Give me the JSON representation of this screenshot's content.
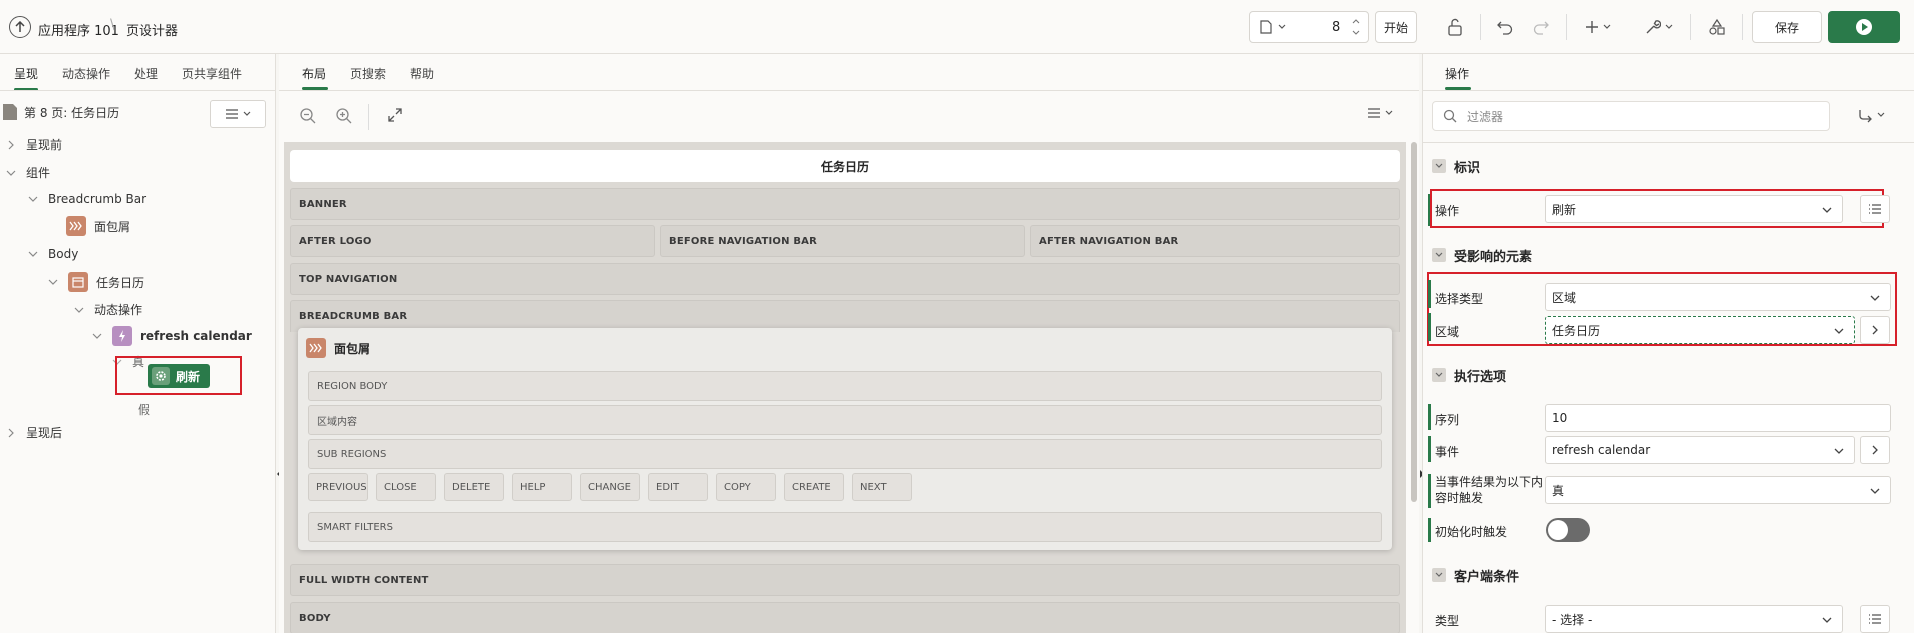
{
  "header": {
    "app_label": "应用程序 101",
    "page_label": "页设计器",
    "page_number": "8",
    "start_label": "开始",
    "save_label": "保存"
  },
  "left": {
    "tabs": [
      "呈现",
      "动态操作",
      "处理",
      "页共享组件"
    ],
    "page_title": "第 8 页: 任务日历",
    "tree": {
      "pre_render": "呈现前",
      "components": "组件",
      "breadcrumb_bar": "Breadcrumb Bar",
      "breadcrumb": "面包屑",
      "body": "Body",
      "task_calendar": "任务日历",
      "dynamic_actions": "动态操作",
      "refresh_calendar": "refresh calendar",
      "true_label": "真",
      "refresh_action": "刷新",
      "false_label": "假",
      "post_render": "呈现后"
    }
  },
  "middle": {
    "tabs": [
      "布局",
      "页搜索",
      "帮助"
    ],
    "canvas": {
      "page_title": "任务日历",
      "banner": "BANNER",
      "after_logo": "AFTER LOGO",
      "before_nav": "BEFORE NAVIGATION BAR",
      "after_nav": "AFTER NAVIGATION BAR",
      "top_nav": "TOP NAVIGATION",
      "breadcrumb_bar": "BREADCRUMB BAR",
      "region_title": "面包屑",
      "region_body": "REGION BODY",
      "region_content": "区域内容",
      "sub_regions": "SUB REGIONS",
      "buttons": [
        "PREVIOUS",
        "CLOSE",
        "DELETE",
        "HELP",
        "CHANGE",
        "EDIT",
        "COPY",
        "CREATE",
        "NEXT"
      ],
      "smart_filters": "SMART FILTERS",
      "full_width": "FULL WIDTH CONTENT",
      "body": "BODY"
    }
  },
  "right": {
    "tab": "操作",
    "filter_placeholder": "过滤器",
    "sections": {
      "identification": "标识",
      "affected": "受影响的元素",
      "execution": "执行选项",
      "client_condition": "客户端条件"
    },
    "props": {
      "action_label": "操作",
      "action_value": "刷新",
      "selection_type_label": "选择类型",
      "selection_type_value": "区域",
      "region_label": "区域",
      "region_value": "任务日历",
      "sequence_label": "序列",
      "sequence_value": "10",
      "event_label": "事件",
      "event_value": "refresh calendar",
      "fire_when_label": "当事件结果为以下内容时触发",
      "fire_when_value": "真",
      "fire_on_init_label": "初始化时触发",
      "type_label": "类型",
      "type_value": "- 选择 -"
    }
  },
  "colors": {
    "accent_green": "#2a7a4a",
    "highlight_red": "#d6202a",
    "breadcrumb_icon": "#c9866a",
    "action_icon": "#b78fc0"
  }
}
